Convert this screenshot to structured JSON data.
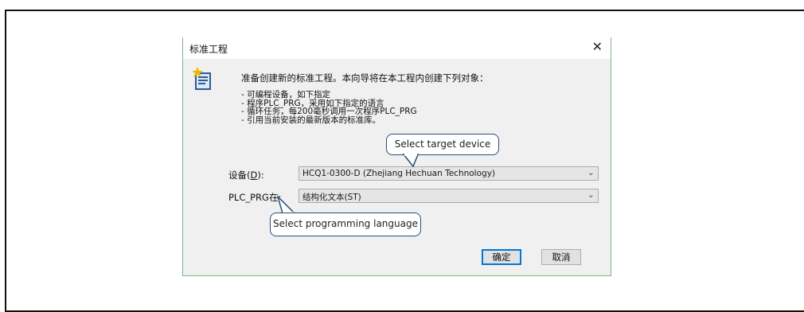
{
  "dialog": {
    "title": "标准工程",
    "close_glyph": "✕",
    "intro": "准备创建新的标准工程。本向导将在本工程内创建下列对象：",
    "bullets": [
      "- 可编程设备，如下指定",
      "- 程序PLC_PRG，采用如下指定的语言",
      "- 循环任务，每200毫秒调用一次程序PLC_PRG",
      "- 引用当前安装的最新版本的标准库。"
    ],
    "device_label_prefix": "设备(",
    "device_label_key": "D",
    "device_label_suffix": "):",
    "device_value": "HCQ1-0300-D (Zhejiang Hechuan Technology)",
    "plc_label": "PLC_PRG在:",
    "plc_value": "结构化文本(ST)",
    "ok_label": "确定",
    "cancel_label": "取消"
  },
  "callouts": {
    "device": "Select target device",
    "language": "Select programming language"
  },
  "icons": {
    "wizard": "wizard-icon",
    "close": "close-icon",
    "dropdown": "chevron-down-icon"
  },
  "colors": {
    "dialog_border": "#83b483",
    "callout_border": "#2b4d7a",
    "ok_border": "#0078d7"
  }
}
